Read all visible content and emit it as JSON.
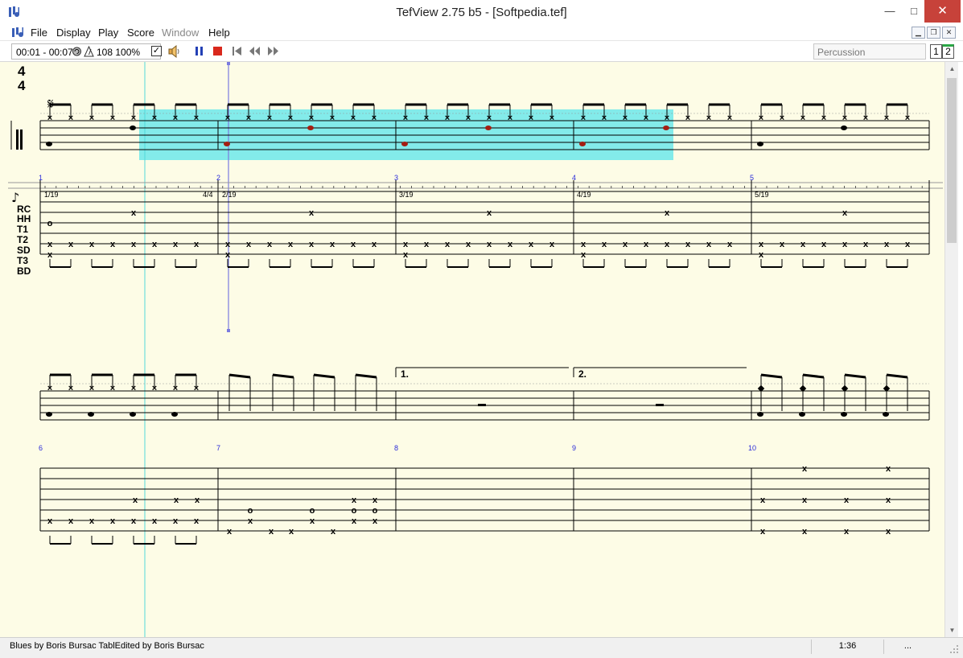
{
  "window": {
    "title": "TefView 2.75 b5  - [Softpedia.tef]",
    "minimize_glyph": "—",
    "maximize_glyph": "□",
    "close_glyph": "✕"
  },
  "menu": {
    "items": [
      "File",
      "Display",
      "Play",
      "Score",
      "Window",
      "Help"
    ],
    "disabled": [
      "Window"
    ]
  },
  "toolbar": {
    "time_range": "00:01 - 00:07",
    "tempo": "108",
    "zoom": "100%",
    "checkbox_checked": true,
    "instrument": "Percussion",
    "page_buttons": [
      "1",
      "2"
    ],
    "active_page": "2",
    "icons": [
      "loop-icon",
      "metronome-icon",
      "speaker-icon",
      "pause-icon",
      "stop-icon",
      "rewind-start-icon",
      "rewind-icon",
      "fast-forward-icon"
    ]
  },
  "score": {
    "time_signature": {
      "top": "4",
      "bottom": "4"
    },
    "system1": {
      "measure_numbers": [
        "1",
        "2",
        "3",
        "4",
        "5"
      ],
      "beat_labels": [
        "1/19",
        "4/4",
        "2/19",
        "3/19",
        "4/19",
        "5/19"
      ]
    },
    "drum_labels": [
      "RC",
      "HH",
      "T1",
      "T2",
      "SD",
      "T3",
      "BD"
    ],
    "system2": {
      "measure_numbers": [
        "6",
        "7",
        "8",
        "9",
        "10"
      ],
      "endings": [
        "1.",
        "2."
      ]
    },
    "tab_notes": {
      "x": "x",
      "o": "o"
    }
  },
  "status": {
    "credits": "Blues  by Boris Bursac  TablEdited by Boris Bursac",
    "time": "1:36",
    "extra": "..."
  },
  "colors": {
    "score_background": "#fdfce6",
    "selection": "#6de8ea",
    "measure_number": "#2b2bd8",
    "playhead": "#7a7adf",
    "active_note": "#a41e12",
    "close_button": "#c7423a"
  }
}
